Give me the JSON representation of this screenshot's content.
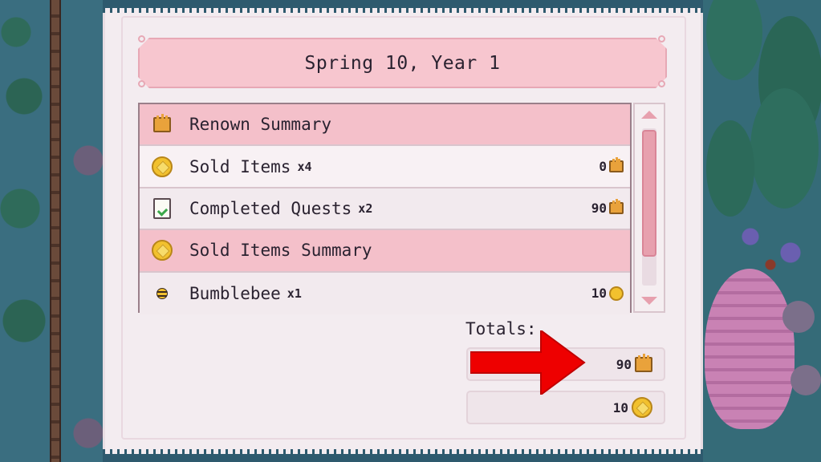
{
  "date": "Spring 10, Year 1",
  "rows": [
    {
      "type": "header",
      "icon": "crown-icon",
      "label": "Renown Summary",
      "qty": "",
      "value": "",
      "value_icon": ""
    },
    {
      "type": "item",
      "icon": "coin-icon",
      "label": "Sold Items",
      "qty": "x4",
      "value": "0",
      "value_icon": "crown-icon"
    },
    {
      "type": "item",
      "icon": "quest-paper-icon",
      "label": "Completed Quests",
      "qty": "x2",
      "value": "90",
      "value_icon": "crown-icon"
    },
    {
      "type": "header",
      "icon": "coin-icon",
      "label": "Sold Items Summary",
      "qty": "",
      "value": "",
      "value_icon": ""
    },
    {
      "type": "item",
      "icon": "bumblebee-icon",
      "label": "Bumblebee",
      "qty": "x1",
      "value": "10",
      "value_icon": "coin-icon"
    }
  ],
  "totals": {
    "label": "Totals:",
    "renown": "90",
    "gold": "10"
  },
  "colors": {
    "header_row": "#f4c0ca",
    "panel": "#f3ecf0",
    "arrow": "#ee0000"
  }
}
